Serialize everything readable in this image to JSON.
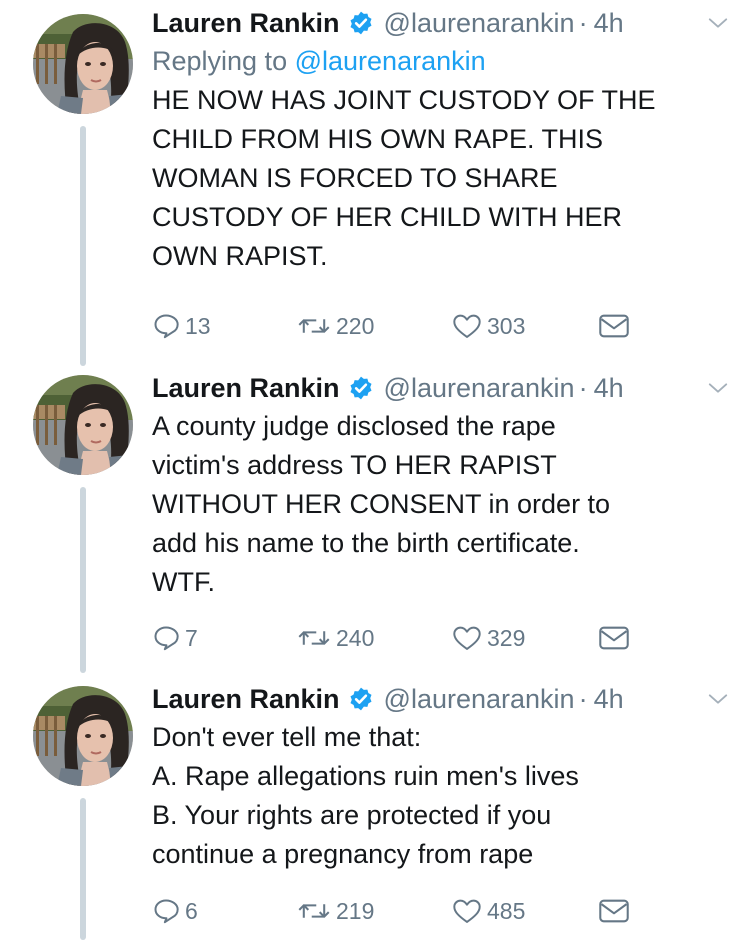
{
  "tweets": [
    {
      "author": {
        "name": "Lauren Rankin",
        "handle": "@laurenarankin",
        "time": "4h"
      },
      "replying_label": "Replying to",
      "replying_handle": "@laurenarankin",
      "lines": [
        "HE NOW HAS JOINT CUSTODY OF THE",
        "CHILD FROM HIS OWN RAPE. THIS",
        "WOMAN IS FORCED TO SHARE",
        "CUSTODY OF HER CHILD WITH HER",
        "OWN RAPIST."
      ],
      "replies": "13",
      "retweets": "220",
      "likes": "303"
    },
    {
      "author": {
        "name": "Lauren Rankin",
        "handle": "@laurenarankin",
        "time": "4h"
      },
      "lines": [
        "A county judge disclosed the rape",
        "victim's address TO HER RAPIST",
        "WITHOUT HER CONSENT in order to",
        "add his name to the birth certificate.",
        "WTF."
      ],
      "replies": "7",
      "retweets": "240",
      "likes": "329"
    },
    {
      "author": {
        "name": "Lauren Rankin",
        "handle": "@laurenarankin",
        "time": "4h"
      },
      "lines": [
        "Don't ever tell me that:",
        "A. Rape allegations ruin men's lives",
        "B. Your rights are protected if you",
        "continue a pregnancy from rape"
      ],
      "replies": "6",
      "retweets": "219",
      "likes": "485"
    }
  ],
  "separator": "·",
  "colors": {
    "text": "#14171a",
    "secondary": "#657786",
    "link": "#1da1f2",
    "verified": "#1da1f2",
    "thread_line": "#ccd6dd"
  },
  "icons": [
    "verified-badge-icon",
    "chevron-down-icon",
    "reply-icon",
    "retweet-icon",
    "like-icon",
    "direct-message-icon"
  ]
}
